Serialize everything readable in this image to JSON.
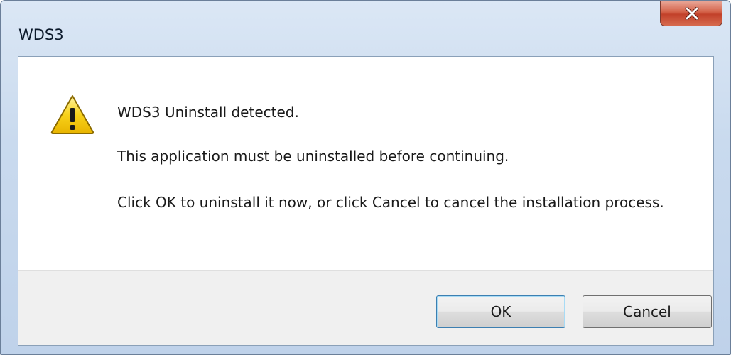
{
  "window": {
    "title": "WDS3"
  },
  "message": {
    "line1": "WDS3 Uninstall detected.",
    "line2": "This application must be uninstalled before continuing.",
    "line3": "Click OK to uninstall it now, or click Cancel to cancel the installation process."
  },
  "buttons": {
    "ok_label": "OK",
    "cancel_label": "Cancel"
  },
  "icons": {
    "warning": "warning-icon",
    "close": "close-icon"
  },
  "colors": {
    "close_button": "#c2412a",
    "warning_yellow": "#f5c400",
    "default_button_border": "#3c7fb1"
  }
}
